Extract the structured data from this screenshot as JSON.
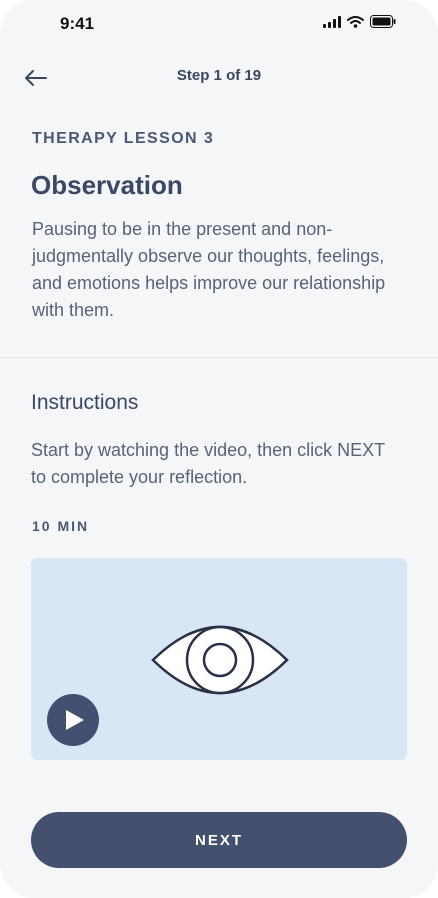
{
  "status_bar": {
    "time": "9:41"
  },
  "header": {
    "step_label": "Step 1 of 19"
  },
  "lesson": {
    "eyebrow": "THERAPY LESSON 3",
    "title": "Observation",
    "description": "Pausing to be in the present and non-judgmentally observe our thoughts, feelings, and emotions helps improve our relationship with them."
  },
  "instructions": {
    "title": "Instructions",
    "text": "Start by watching the video, then click NEXT to complete your reflection.",
    "duration": "10 MIN"
  },
  "footer": {
    "next_label": "NEXT"
  },
  "colors": {
    "accent": "#45506f",
    "video_bg": "#d8e6f5",
    "background": "#f5f6f8",
    "text": "#596275",
    "heading": "#3a4766"
  },
  "icons": [
    "back-arrow-icon",
    "signal-icon",
    "wifi-icon",
    "battery-icon",
    "eye-icon",
    "play-icon"
  ]
}
